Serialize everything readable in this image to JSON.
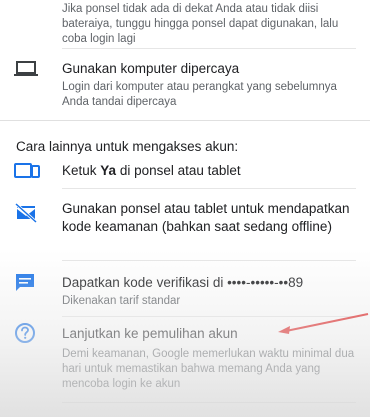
{
  "top_item": {
    "description": "Jika ponsel tidak ada di dekat Anda atau tidak diisi bateraiya, tunggu hingga ponsel dapat digunakan, lalu coba login lagi"
  },
  "trusted_computer": {
    "title": "Gunakan komputer dipercaya",
    "description": "Login dari komputer atau perangkat yang sebelumnya Anda tandai dipercaya"
  },
  "section_label": "Cara lainnya untuk mengakses akun:",
  "tap_yes": {
    "title_prefix": "Ketuk ",
    "title_bold": "Ya",
    "title_suffix": " di ponsel atau tablet"
  },
  "security_code": {
    "title": "Gunakan ponsel atau tablet untuk mendapatkan kode keamanan (bahkan saat sedang offline)"
  },
  "sms_code": {
    "title": "Dapatkan kode verifikasi di ••••-•••••-••89",
    "description": "Dikenakan tarif standar"
  },
  "recovery": {
    "title": "Lanjutkan ke pemulihan akun",
    "description": "Demi keamanan, Google memerlukan waktu minimal dua hari untuk memastikan bahwa memang Anda yang mencoba login ke akun"
  },
  "colors": {
    "icon_blue": "#1a73e8",
    "annotation_arrow": "#e02424"
  },
  "icons": [
    "laptop-icon",
    "phone-tablet-icon",
    "offline-phone-icon",
    "sms-icon",
    "help-icon",
    "red-arrow-annotation"
  ]
}
